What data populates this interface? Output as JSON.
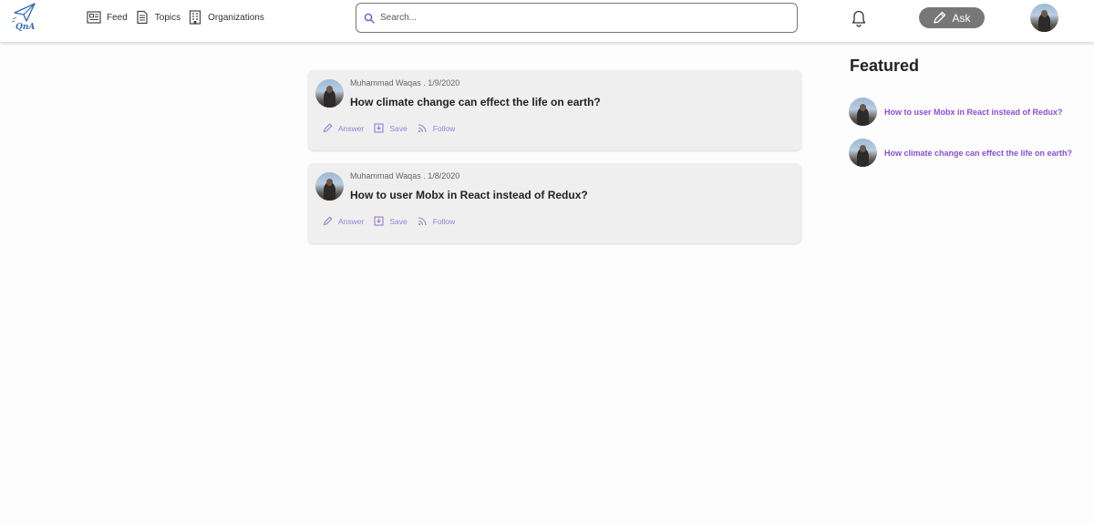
{
  "header": {
    "logo_text": "QnA",
    "nav": [
      {
        "label": "Feed",
        "icon": "newspaper-icon"
      },
      {
        "label": "Topics",
        "icon": "document-icon"
      },
      {
        "label": "Organizations",
        "icon": "building-icon"
      }
    ],
    "search": {
      "placeholder": "Search...",
      "value": ""
    },
    "ask_label": "Ask",
    "icons": {
      "notifications": "bell-icon",
      "ask": "pencil-icon",
      "search": "search-icon"
    }
  },
  "feed": [
    {
      "author": "Muhammad Waqas",
      "date": "1/9/2020",
      "meta": "Muhammad Waqas . 1/9/2020",
      "question": "How climate change can effect the life on earth?",
      "actions": {
        "answer": "Answer",
        "save": "Save",
        "follow": "Follow"
      }
    },
    {
      "author": "Muhammad Waqas",
      "date": "1/8/2020",
      "meta": "Muhammad Waqas . 1/8/2020",
      "question": "How to user Mobx in React instead of Redux?",
      "actions": {
        "answer": "Answer",
        "save": "Save",
        "follow": "Follow"
      }
    }
  ],
  "featured": {
    "title": "Featured",
    "items": [
      {
        "question": "How to user Mobx in React instead of Redux?"
      },
      {
        "question": "How climate change can effect the life on earth?"
      }
    ]
  },
  "colors": {
    "accent": "#8a4fd6",
    "action": "#9a7fd1",
    "ask_button": "#777777",
    "card_bg": "#efefef"
  }
}
